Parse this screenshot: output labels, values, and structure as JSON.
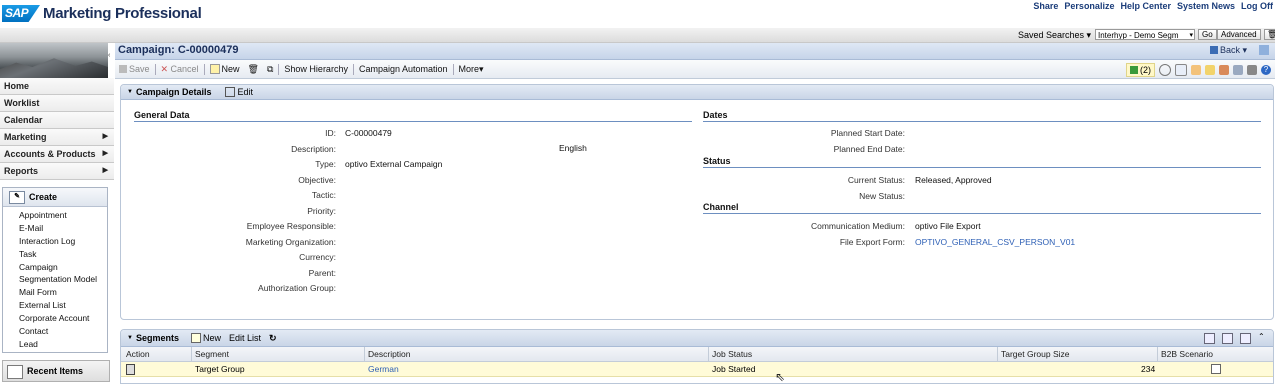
{
  "header": {
    "logo_text": "SAP",
    "app_title": "Marketing Professional",
    "links": [
      "Share",
      "Personalize",
      "Help Center",
      "System News",
      "Log Off"
    ]
  },
  "search": {
    "saved_searches_label": "Saved Searches",
    "selected": "Interhyp - Demo Segm",
    "go_label": "Go",
    "advanced_label": "Advanced"
  },
  "nav": {
    "items": [
      {
        "label": "Home",
        "has_arrow": false
      },
      {
        "label": "Worklist",
        "has_arrow": false
      },
      {
        "label": "Calendar",
        "has_arrow": false
      },
      {
        "label": "Marketing",
        "has_arrow": true
      },
      {
        "label": "Accounts & Products",
        "has_arrow": true
      },
      {
        "label": "Reports",
        "has_arrow": true
      }
    ],
    "create": {
      "title": "Create",
      "items": [
        "Appointment",
        "E-Mail",
        "Interaction Log",
        "Task",
        "Campaign",
        "Segmentation Model",
        "Mail Form",
        "External List",
        "Corporate Account",
        "Contact",
        "Lead"
      ]
    },
    "recent_items_label": "Recent Items"
  },
  "page": {
    "title": "Campaign: C-00000479",
    "back_label": "Back",
    "toolbar": {
      "save": "Save",
      "cancel": "Cancel",
      "new": "New",
      "show_hierarchy": "Show Hierarchy",
      "campaign_automation": "Campaign Automation",
      "more": "More",
      "alerts_count": "(2)"
    }
  },
  "details": {
    "panel_title": "Campaign Details",
    "edit_label": "Edit",
    "general": {
      "title": "General Data",
      "fields": [
        {
          "label": "ID:",
          "value": "C-00000479"
        },
        {
          "label": "Description:",
          "value": ""
        },
        {
          "label": "Type:",
          "value": "optivo External Campaign"
        },
        {
          "label": "Objective:",
          "value": ""
        },
        {
          "label": "Tactic:",
          "value": ""
        },
        {
          "label": "Priority:",
          "value": ""
        },
        {
          "label": "Employee Responsible:",
          "value": ""
        },
        {
          "label": "Marketing Organization:",
          "value": ""
        },
        {
          "label": "Currency:",
          "value": ""
        },
        {
          "label": "Parent:",
          "value": ""
        },
        {
          "label": "Authorization Group:",
          "value": ""
        }
      ],
      "description_language": "English"
    },
    "dates": {
      "title": "Dates",
      "fields": [
        {
          "label": "Planned Start Date:",
          "value": ""
        },
        {
          "label": "Planned End Date:",
          "value": ""
        }
      ]
    },
    "status": {
      "title": "Status",
      "fields": [
        {
          "label": "Current Status:",
          "value": "Released, Approved"
        },
        {
          "label": "New Status:",
          "value": ""
        }
      ]
    },
    "channel": {
      "title": "Channel",
      "fields": [
        {
          "label": "Communication Medium:",
          "value": "optivo File Export"
        },
        {
          "label": "File Export Form:",
          "value": "OPTIVO_GENERAL_CSV_PERSON_V01"
        }
      ]
    }
  },
  "segments": {
    "title": "Segments",
    "new_label": "New",
    "edit_list_label": "Edit List",
    "columns": [
      "Action",
      "Segment",
      "Description",
      "Job Status",
      "Target Group Size",
      "B2B Scenario"
    ],
    "rows": [
      {
        "segment": "Target Group",
        "description": "German",
        "job_status": "Job Started",
        "size": "234",
        "b2b": false
      }
    ]
  },
  "colors": {
    "brand_blue": "#1b2f5b",
    "link_blue": "#2d5fb5",
    "panel_header": "#c9d5e7",
    "selected_row": "#fffbd8"
  }
}
